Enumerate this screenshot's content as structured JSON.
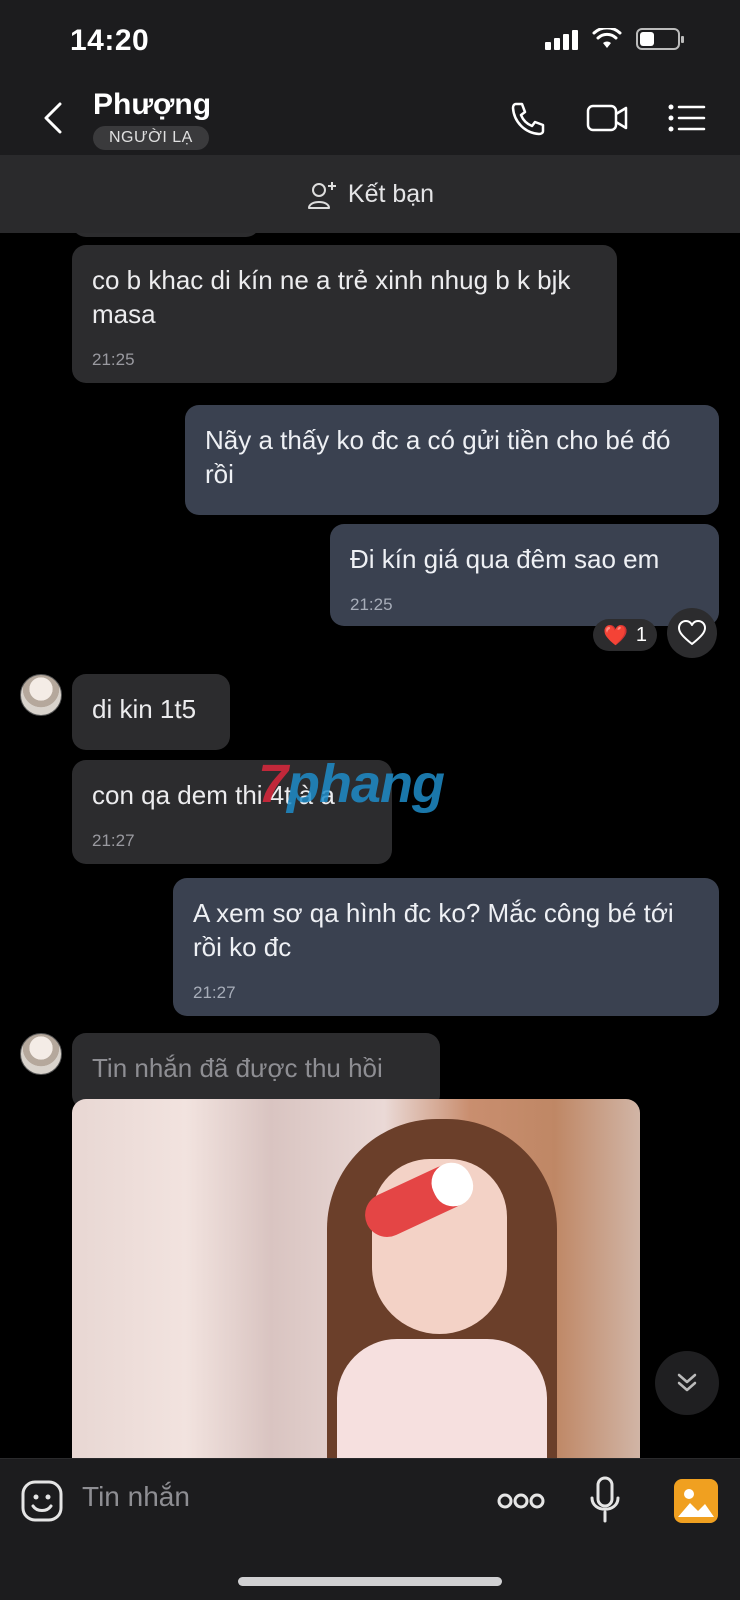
{
  "status_bar": {
    "time": "14:20",
    "battery_level": 0.35
  },
  "header": {
    "contact_name": "Phượng",
    "badge": "NGƯỜI LẠ",
    "icons": [
      "chevron-left-icon",
      "phone-icon",
      "video-call-icon",
      "menu-list-icon"
    ]
  },
  "friend_bar": {
    "label": "Kết bạn"
  },
  "messages": [
    {
      "id": "m1",
      "direction": "in",
      "text": "co b khac di kín ne a trẻ xinh nhug b k bjk masa",
      "time": "21:25"
    },
    {
      "id": "m2",
      "direction": "out",
      "text": "Nãy a thấy ko đc a có gửi tiền cho bé đó rồi"
    },
    {
      "id": "m3",
      "direction": "out",
      "text": "Đi kín giá qua đêm sao em",
      "time": "21:25",
      "reaction": {
        "emoji": "❤️",
        "count": "1"
      }
    },
    {
      "id": "m4",
      "direction": "in",
      "text": "di kin 1t5"
    },
    {
      "id": "m5",
      "direction": "in",
      "text": "con qa dem thi 4t à a",
      "time": "21:27"
    },
    {
      "id": "m6",
      "direction": "out",
      "text": "A xem sơ qa hình đc ko? Mắc công bé tới rồi ko đc",
      "time": "21:27"
    },
    {
      "id": "m7",
      "direction": "in",
      "text": "Tin nhắn đã được thu hồi",
      "recalled": true
    },
    {
      "id": "m8",
      "direction": "in",
      "type": "photo"
    }
  ],
  "watermark": {
    "part1": "7",
    "part2": "phang"
  },
  "composer": {
    "placeholder": "Tin nhắn"
  },
  "colors": {
    "incoming": "#2c2c2e",
    "outgoing": "#3a4150",
    "background": "#000000",
    "accent": "#f0a020"
  }
}
